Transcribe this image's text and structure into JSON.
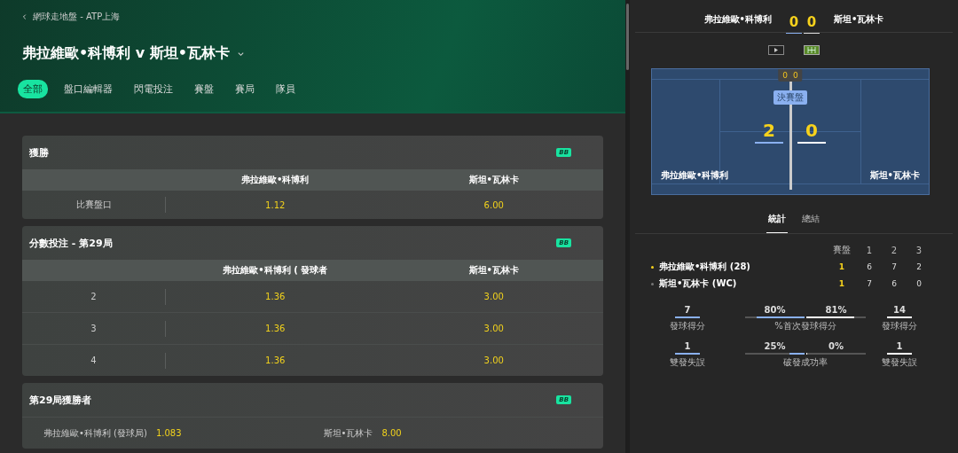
{
  "breadcrumb": "網球走地盤 - ATP上海",
  "title": "弗拉維歐•科博利 v 斯坦•瓦林卡",
  "tabs": [
    {
      "label": "全部",
      "selected": true
    },
    {
      "label": "盤口編輯器",
      "selected": false
    },
    {
      "label": "閃電投注",
      "selected": false
    },
    {
      "label": "賽盤",
      "selected": false
    },
    {
      "label": "賽局",
      "selected": false
    },
    {
      "label": "隊員",
      "selected": false
    }
  ],
  "markets": [
    {
      "kind": "table",
      "title": "獲勝",
      "badge": "BB",
      "columns": [
        "弗拉維歐•科博利",
        "斯坦•瓦林卡"
      ],
      "rows": [
        {
          "label": "比賽盤口",
          "odds": [
            "1.12",
            "6.00"
          ]
        }
      ]
    },
    {
      "kind": "table",
      "title": "分數投注 - 第29局",
      "badge": "BB",
      "columns": [
        "弗拉維歐•科博利 ( 發球者",
        "斯坦•瓦林卡"
      ],
      "rows": [
        {
          "label": "2",
          "odds": [
            "1.36",
            "3.00"
          ]
        },
        {
          "label": "3",
          "odds": [
            "1.36",
            "3.00"
          ]
        },
        {
          "label": "4",
          "odds": [
            "1.36",
            "3.00"
          ]
        }
      ]
    },
    {
      "kind": "inline",
      "title": "第29局獲勝者",
      "badge": "BB",
      "selections": [
        {
          "name": "弗拉維歐•科博利 (發球局)",
          "odds": "1.083"
        },
        {
          "name": "斯坦•瓦林卡",
          "odds": "8.00"
        }
      ]
    }
  ],
  "scoreboard": {
    "home": "弗拉維歐•科博利",
    "home_points": "0",
    "away_points": "0",
    "away": "斯坦•瓦林卡"
  },
  "media_buttons": [
    {
      "kind": "video",
      "selected": false
    },
    {
      "kind": "court",
      "selected": true
    }
  ],
  "court": {
    "points_home": "0",
    "points_away": "0",
    "set_label": "決賽盤",
    "games_home": "2",
    "games_away": "0",
    "home": "弗拉維歐•科博利",
    "away": "斯坦•瓦林卡"
  },
  "stats_tabs": [
    {
      "label": "統計",
      "selected": true
    },
    {
      "label": "總結",
      "selected": false
    }
  ],
  "sets_table": {
    "columns": [
      "賽盤",
      "1",
      "2",
      "3"
    ],
    "rows": [
      {
        "name": "弗拉維歐•科博利 (28)",
        "serving": true,
        "sets": "1",
        "games": [
          "6",
          "7",
          "2"
        ]
      },
      {
        "name": "斯坦•瓦林卡 (WC)",
        "serving": false,
        "sets": "1",
        "games": [
          "7",
          "6",
          "0"
        ]
      }
    ]
  },
  "stats": [
    {
      "home": {
        "value": "7",
        "label": "發球得分"
      },
      "center": {
        "bars": [
          {
            "value": "80%",
            "level": 0.8
          },
          {
            "value": "81%",
            "level": 0.81
          }
        ],
        "label": "%首次發球得分"
      },
      "away": {
        "value": "14",
        "label": "發球得分"
      }
    },
    {
      "home": {
        "value": "1",
        "label": "雙發失誤"
      },
      "center": {
        "bars": [
          {
            "value": "25%",
            "level": 0.25
          },
          {
            "value": "0%",
            "level": 0
          }
        ],
        "label": "破發成功率"
      },
      "away": {
        "value": "1",
        "label": "雙發失誤"
      }
    }
  ]
}
